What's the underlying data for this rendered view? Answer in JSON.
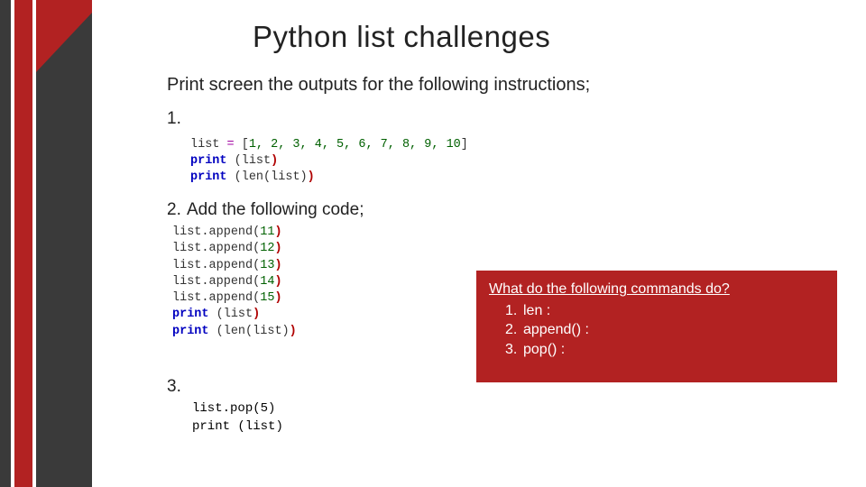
{
  "title": "Python list challenges",
  "intro": "Print screen the outputs for the following instructions;",
  "items": {
    "n1": "1.",
    "n2": "2.",
    "n2_text": "Add the following code;",
    "n3": "3."
  },
  "code1": {
    "l1_a": "list ",
    "l1_b": "=",
    "l1_c": " [",
    "l1_d": "1, 2, 3, 4, 5, 6, 7, 8, 9, 10",
    "l1_e": "]",
    "l2_a": "print",
    "l2_b": " (",
    "l2_c": "list",
    "l2_d": ")",
    "l3_a": "print",
    "l3_b": " (",
    "l3_c": "len",
    "l3_d": "(",
    "l3_e": "list",
    "l3_f": ")",
    "l3_g": ")"
  },
  "code2": {
    "a1_a": "list.",
    "a1_b": "append(",
    "a1_c": "11",
    "a1_d": ")",
    "a2_a": "list.",
    "a2_b": "append(",
    "a2_c": "12",
    "a2_d": ")",
    "a3_a": "list.",
    "a3_b": "append(",
    "a3_c": "13",
    "a3_d": ")",
    "a4_a": "list.",
    "a4_b": "append(",
    "a4_c": "14",
    "a4_d": ")",
    "a5_a": "list.",
    "a5_b": "append(",
    "a5_c": "15",
    "a5_d": ")",
    "p1_a": "print",
    "p1_b": " (",
    "p1_c": "list",
    "p1_d": ")",
    "p2_a": "print",
    "p2_b": " (",
    "p2_c": "len",
    "p2_d": "(",
    "p2_e": "list",
    "p2_f": ")",
    "p2_g": ")"
  },
  "code3": {
    "l1_a": "list.",
    "l1_b": "pop(",
    "l1_c": "5",
    "l1_d": ")",
    "l2_a": "print",
    "l2_b": " (",
    "l2_c": "list",
    "l2_d": ")"
  },
  "callout": {
    "heading": "What do the following commands do?",
    "items": [
      {
        "n": "1.",
        "text": "len :"
      },
      {
        "n": "2.",
        "text": "append() :"
      },
      {
        "n": "3.",
        "text": "pop() :"
      }
    ]
  }
}
